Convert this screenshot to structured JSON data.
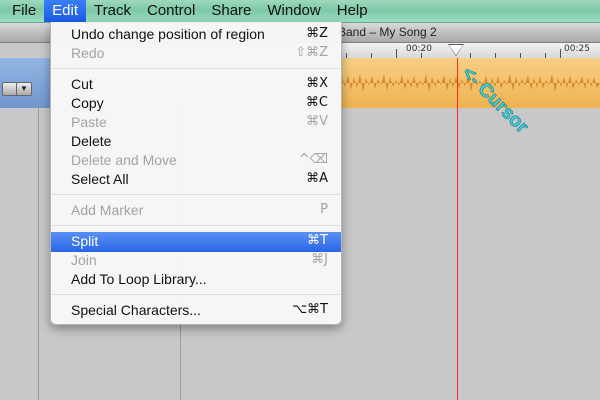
{
  "menubar": {
    "items": [
      "File",
      "Edit",
      "Track",
      "Control",
      "Share",
      "Window",
      "Help"
    ],
    "active": "Edit"
  },
  "window": {
    "title": "Band – My Song 2"
  },
  "ruler": {
    "labels": [
      "00:20",
      "00:25"
    ]
  },
  "annotation": {
    "text": "<- Cursor",
    "color": "#40d0d8"
  },
  "edit_menu": {
    "undo": {
      "label": "Undo change position of region",
      "shortcut": "⌘Z"
    },
    "redo": {
      "label": "Redo",
      "shortcut": "⇧⌘Z"
    },
    "cut": {
      "label": "Cut",
      "shortcut": "⌘X"
    },
    "copy": {
      "label": "Copy",
      "shortcut": "⌘C"
    },
    "paste": {
      "label": "Paste",
      "shortcut": "⌘V"
    },
    "delete": {
      "label": "Delete",
      "shortcut": ""
    },
    "delete_and_move": {
      "label": "Delete and Move",
      "shortcut": "^⌫"
    },
    "select_all": {
      "label": "Select All",
      "shortcut": "⌘A"
    },
    "add_marker": {
      "label": "Add Marker",
      "shortcut": "P"
    },
    "split": {
      "label": "Split",
      "shortcut": "⌘T"
    },
    "join": {
      "label": "Join",
      "shortcut": "⌘J"
    },
    "add_to_loop_library": {
      "label": "Add To Loop Library...",
      "shortcut": ""
    },
    "special_characters": {
      "label": "Special Characters...",
      "shortcut": "⌥⌘T"
    }
  },
  "colors": {
    "menubar": "#8fd0b2",
    "selection": "#2f6fe9",
    "region": "#f2be63",
    "cursor_line": "#ff2a2a"
  }
}
